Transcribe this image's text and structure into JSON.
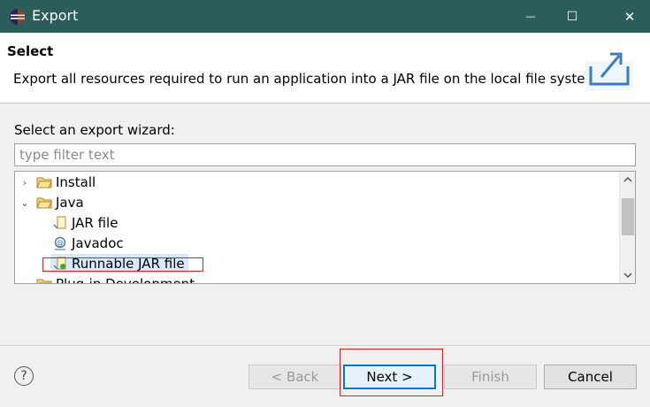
{
  "window": {
    "title": "Export",
    "app_icon": "eclipse-icon",
    "controls": {
      "minimize": "—",
      "maximize": "☐",
      "close": "✕"
    }
  },
  "header": {
    "title": "Select",
    "description": "Export all resources required to run an application into a JAR file on the local file system.",
    "icon": "export-wizard-icon"
  },
  "wizard": {
    "label": "Select an export wizard:",
    "filter_placeholder": "type filter text",
    "filter_value": ""
  },
  "tree": {
    "items": [
      {
        "label": "Install",
        "expanded": false,
        "icon": "folder-icon"
      },
      {
        "label": "Java",
        "expanded": true,
        "icon": "folder-icon"
      },
      {
        "label": "JAR file",
        "icon": "jar-file-icon"
      },
      {
        "label": "Javadoc",
        "icon": "javadoc-icon"
      },
      {
        "label": "Runnable JAR file",
        "icon": "runnable-jar-icon",
        "selected": true
      },
      {
        "label": "Plug-in Development",
        "expanded": false,
        "icon": "folder-icon"
      }
    ]
  },
  "buttons": {
    "back": "< Back",
    "next": "Next >",
    "finish": "Finish",
    "cancel": "Cancel",
    "help": "?"
  },
  "colors": {
    "titlebar": "#2b5d5a",
    "selection": "#d9e8fb",
    "highlight_box": "#e02020",
    "default_button_border": "#0078d7"
  }
}
